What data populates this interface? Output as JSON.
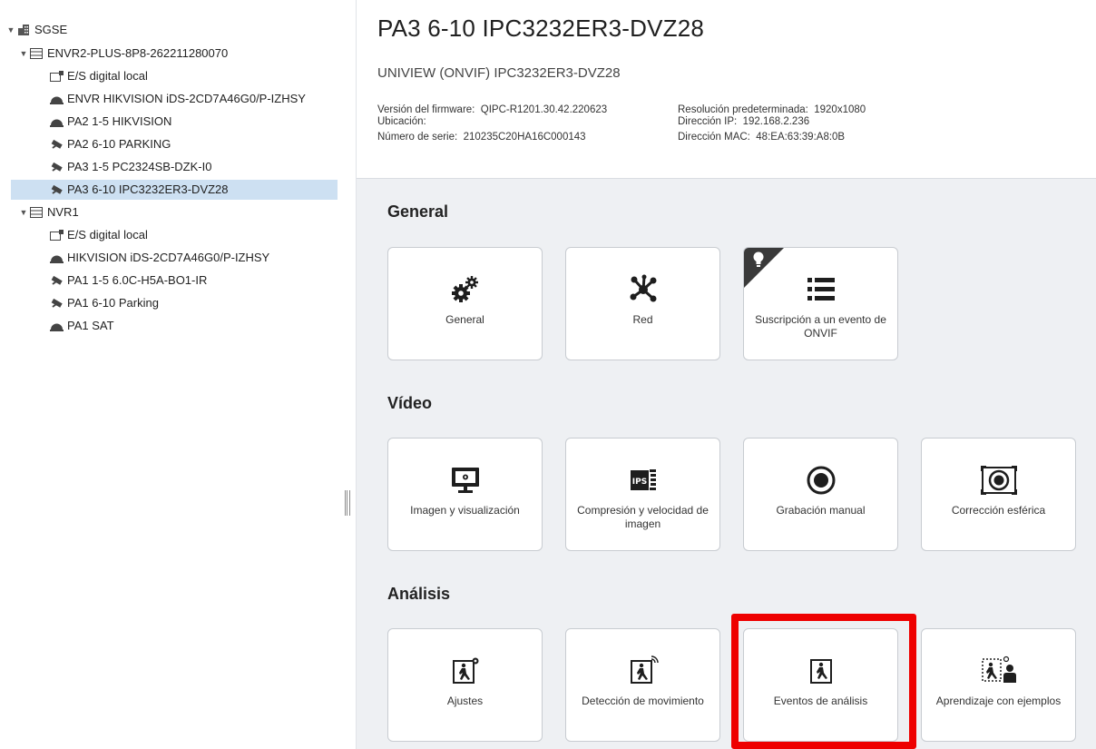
{
  "tree": {
    "root": "SGSE",
    "items": [
      {
        "label": "ENVR2-PLUS-8P8-262211280070",
        "icon": "recorder-icon",
        "name": "tree-node-envr2"
      },
      {
        "label": "E/S digital local",
        "icon": "io-port-icon",
        "name": "tree-node-io-1"
      },
      {
        "label": "ENVR HIKVISION iDS-2CD7A46G0/P-IZHSY",
        "icon": "dome-camera-icon",
        "name": "tree-node-envr-hikvision"
      },
      {
        "label": "PA2 1-5 HIKVISION",
        "icon": "dome-camera-icon",
        "name": "tree-node-pa2-1-5"
      },
      {
        "label": "PA2 6-10 PARKING",
        "icon": "bullet-camera-icon",
        "name": "tree-node-pa2-6-10"
      },
      {
        "label": "PA3 1-5 PC2324SB-DZK-I0",
        "icon": "bullet-camera-icon",
        "name": "tree-node-pa3-1-5"
      },
      {
        "label": "PA3 6-10 IPC3232ER3-DVZ28",
        "icon": "bullet-camera-icon",
        "name": "tree-node-pa3-6-10"
      },
      {
        "label": "NVR1",
        "icon": "recorder-icon",
        "name": "tree-node-nvr1"
      },
      {
        "label": "E/S digital local",
        "icon": "io-port-icon",
        "name": "tree-node-io-2"
      },
      {
        "label": "HIKVISION iDS-2CD7A46G0/P-IZHSY",
        "icon": "dome-camera-icon",
        "name": "tree-node-hikvision"
      },
      {
        "label": "PA1 1-5 6.0C-H5A-BO1-IR",
        "icon": "bullet-camera-icon",
        "name": "tree-node-pa1-1-5"
      },
      {
        "label": "PA1 6-10 Parking",
        "icon": "bullet-camera-icon",
        "name": "tree-node-pa1-6-10"
      },
      {
        "label": "PA1 SAT",
        "icon": "dome-camera-icon",
        "name": "tree-node-pa1-sat"
      }
    ]
  },
  "header": {
    "title": "PA3 6-10 IPC3232ER3-DVZ28",
    "model": "UNIVIEW (ONVIF) IPC3232ER3-DVZ28",
    "firmware_label": "Versión del firmware:",
    "firmware_value": "QIPC-R1201.30.42.220623",
    "location_label": "Ubicación:",
    "location_value": "",
    "serial_label": "Número de serie:",
    "serial_value": "210235C20HA16C000143",
    "resolution_label": "Resolución predeterminada:",
    "resolution_value": "1920x1080",
    "ip_label": "Dirección IP:",
    "ip_value": "192.168.2.236",
    "mac_label": "Dirección MAC:",
    "mac_value": "48:EA:63:39:A8:0B"
  },
  "sections": {
    "general": {
      "title": "General",
      "tiles": [
        {
          "label": "General",
          "icon": "gears-icon"
        },
        {
          "label": "Red",
          "icon": "network-icon"
        },
        {
          "label": "Suscripción a un evento de ONVIF",
          "icon": "list-icon",
          "badge_icon": "lightbulb-icon"
        }
      ]
    },
    "video": {
      "title": "Vídeo",
      "tiles": [
        {
          "label": "Imagen y visualización",
          "icon": "monitor-icon"
        },
        {
          "label": "Compresión y velocidad de imagen",
          "icon": "ips-film-icon"
        },
        {
          "label": "Grabación manual",
          "icon": "record-icon"
        },
        {
          "label": "Corrección esférica",
          "icon": "fisheye-icon"
        }
      ]
    },
    "analysis": {
      "title": "Análisis",
      "tiles": [
        {
          "label": "Ajustes",
          "icon": "runner-gear-icon"
        },
        {
          "label": "Detección de movimiento",
          "icon": "runner-motion-icon"
        },
        {
          "label": "Eventos de análisis",
          "icon": "runner-icon",
          "highlighted": true
        },
        {
          "label": "Aprendizaje con ejemplos",
          "icon": "runner-person-icon"
        }
      ]
    }
  },
  "colors": {
    "selection": "#cde0f2",
    "panel_background": "#eef0f3",
    "highlight_border": "#ee0000"
  }
}
